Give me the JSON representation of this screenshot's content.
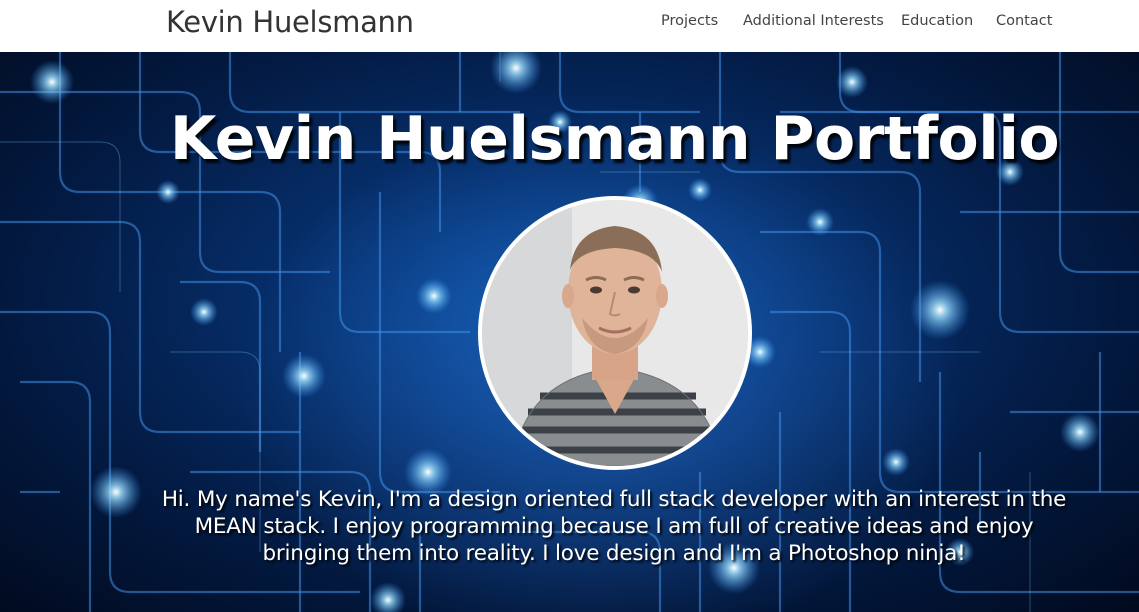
{
  "navbar": {
    "brand": "Kevin Huelsmann",
    "links": [
      {
        "label": "Projects"
      },
      {
        "label": "Additional Interests"
      },
      {
        "label": "Education"
      },
      {
        "label": "Contact"
      }
    ]
  },
  "hero": {
    "title": "Kevin Huelsmann Portfolio",
    "bio": "Hi. My name's Kevin, I'm a design oriented full stack developer with an interest in the MEAN stack. I enjoy programming because I am full of creative ideas and enjoy bringing them into reality. I love design and I'm a Photoshop ninja!",
    "background": "circuit-lines-image",
    "avatar": "profile-photo"
  },
  "colors": {
    "navbar_bg": "#ffffff",
    "brand_text": "#333333",
    "nav_text": "#444444",
    "hero_bg": "#062d68",
    "hero_text": "#ffffff"
  }
}
